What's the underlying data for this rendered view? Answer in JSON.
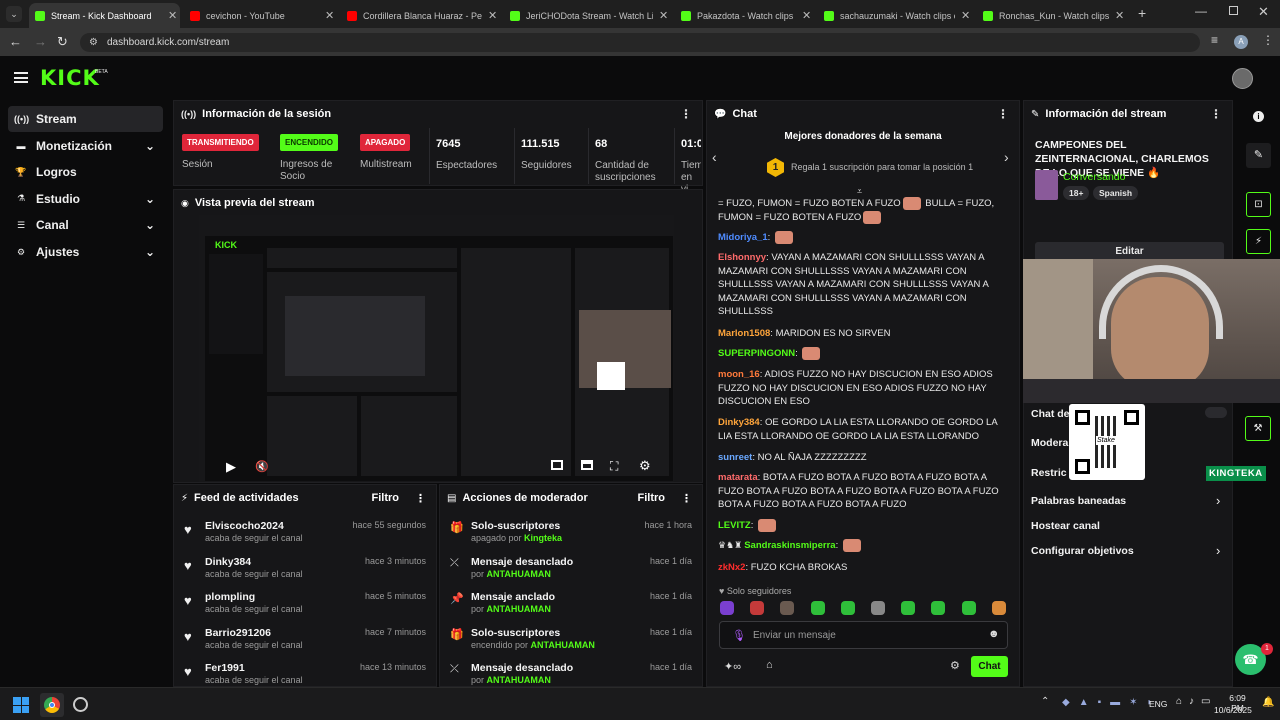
{
  "browser": {
    "tabs": [
      {
        "title": "Stream - Kick Dashboard",
        "color": "#53fc18",
        "active": true
      },
      {
        "title": "cevichon - YouTube",
        "color": "#ff0000",
        "active": false
      },
      {
        "title": "Cordillera Blanca Huaraz - Perú",
        "color": "#ff0000",
        "active": false
      },
      {
        "title": "JeriCHODota Stream - Watch Li",
        "color": "#53fc18",
        "active": false
      },
      {
        "title": "Pakazdota - Watch clips on Kick",
        "color": "#53fc18",
        "active": false
      },
      {
        "title": "sachauzumaki - Watch clips on",
        "color": "#53fc18",
        "active": false
      },
      {
        "title": "Ronchas_Kun - Watch clips on",
        "color": "#53fc18",
        "active": false
      }
    ],
    "url": "dashboard.kick.com/stream",
    "profile_initial": "A"
  },
  "logo": {
    "text": "KICK",
    "beta": "BETA"
  },
  "sidebar": {
    "items": [
      {
        "label": "Stream",
        "selected": true,
        "expandable": false
      },
      {
        "label": "Monetización",
        "selected": false,
        "expandable": true
      },
      {
        "label": "Logros",
        "selected": false,
        "expandable": false
      },
      {
        "label": "Estudio",
        "selected": false,
        "expandable": true
      },
      {
        "label": "Canal",
        "selected": false,
        "expandable": true
      },
      {
        "label": "Ajustes",
        "selected": false,
        "expandable": true
      }
    ]
  },
  "session": {
    "title": "Información de la sesión",
    "stats": [
      {
        "badge": "TRANSMITIENDO",
        "label": "Sesión"
      },
      {
        "badge": "ENCENDIDO",
        "label": "Ingresos de Socio"
      },
      {
        "badge": "APAGADO",
        "label": "Multistream"
      },
      {
        "value": "7645",
        "label": "Espectadores"
      },
      {
        "value": "111.515",
        "label": "Seguidores"
      },
      {
        "value": "68",
        "label": "Cantidad de suscripciones"
      },
      {
        "value": "01:0",
        "label": "Tiem en vi"
      }
    ]
  },
  "preview": {
    "title": "Vista previa del stream"
  },
  "feed": {
    "title": "Feed de actividades",
    "filter": "Filtro",
    "items": [
      {
        "name": "Elviscocho2024",
        "sub": "acaba de seguir el canal",
        "time": "hace 55 segundos"
      },
      {
        "name": "Dinky384",
        "sub": "acaba de seguir el canal",
        "time": "hace 3 minutos"
      },
      {
        "name": "plompling",
        "sub": "acaba de seguir el canal",
        "time": "hace 5 minutos"
      },
      {
        "name": "Barrio291206",
        "sub": "acaba de seguir el canal",
        "time": "hace 7 minutos"
      },
      {
        "name": "Fer1991",
        "sub": "acaba de seguir el canal",
        "time": "hace 13 minutos"
      }
    ]
  },
  "mod": {
    "title": "Acciones de moderador",
    "filter": "Filtro",
    "items": [
      {
        "name": "Solo-suscriptores",
        "pre": "apagado por ",
        "by": "Kingteka",
        "time": "hace 1 hora",
        "icon": "gift"
      },
      {
        "name": "Mensaje desanclado",
        "pre": "por ",
        "by": "ANTAHUAMAN",
        "time": "hace 1 día",
        "icon": "unpin"
      },
      {
        "name": "Mensaje anclado",
        "pre": "por ",
        "by": "ANTAHUAMAN",
        "time": "hace 1 día",
        "icon": "pin"
      },
      {
        "name": "Solo-suscriptores",
        "pre": "encendido por ",
        "by": "ANTAHUAMAN",
        "time": "hace 1 día",
        "icon": "gift"
      },
      {
        "name": "Mensaje desanclado",
        "pre": "por ",
        "by": "ANTAHUAMAN",
        "time": "hace 1 día",
        "icon": "unpin"
      }
    ]
  },
  "chat": {
    "title": "Chat",
    "donors_title": "Mejores donadores de la semana",
    "donor_rank": "1",
    "donor_text": "Regala 1 suscripción para tomar la posición 1",
    "messages": [
      {
        "user": "",
        "color": "#eaeaea",
        "text": "= FUZO, FUMON = FUZO BOTEN A FUZO",
        "emotes": 1,
        "tail": " BULLA = FUZO, FUMON = FUZO BOTEN A FUZO",
        "emotes2": 1
      },
      {
        "user": "Midoriya_1",
        "color": "#4f8cff",
        "text": "",
        "emotes": 1
      },
      {
        "user": "Elshonnyy",
        "color": "#ff6b6b",
        "text": "VAYAN A MAZAMARI CON SHULLLSSS VAYAN A MAZAMARI CON SHULLLSSS VAYAN A MAZAMARI CON SHULLLSSS VAYAN A MAZAMARI CON SHULLLSSS VAYAN A MAZAMARI CON SHULLLSSS VAYAN A MAZAMARI CON SHULLLSSS"
      },
      {
        "user": "Marlon1508",
        "color": "#ffa53b",
        "text": "MARIDON ES NO SIRVEN"
      },
      {
        "user": "SUPERPINGONN",
        "color": "#53fc18",
        "text": "",
        "emotes": 1
      },
      {
        "user": "moon_16",
        "color": "#ff7a3b",
        "text": "ADIOS FUZZO NO HAY DISCUCION EN ESO ADIOS FUZZO NO HAY DISCUCION EN ESO ADIOS FUZZO NO HAY DISCUCION EN ESO"
      },
      {
        "user": "Dinky384",
        "color": "#ffa53b",
        "text": "OE GORDO LA LIA ESTA LLORANDO OE GORDO LA LIA ESTA LLORANDO OE GORDO LA LIA ESTA LLORANDO"
      },
      {
        "user": "sunreet",
        "color": "#6aa8ff",
        "text": "NO AL ÑAJA ZZZZZZZZZ"
      },
      {
        "user": "matarata",
        "color": "#ff6b6b",
        "text": "BOTA A FUZO BOTA A FUZO BOTA A FUZO BOTA A FUZO BOTA A FUZO BOTA A FUZO BOTA A FUZO BOTA A FUZO BOTA A FUZO BOTA A FUZO BOTA A FUZO"
      },
      {
        "user": "LEVITZ",
        "color": "#53fc18",
        "text": "",
        "emotes": 1
      },
      {
        "user": "Sandraskinsmiperra",
        "color": "#53fc18",
        "text": "",
        "emotes": 1,
        "badges": true
      },
      {
        "user": "zkNx2",
        "color": "#ff2d2d",
        "text": "FUZO KCHA BROKAS"
      }
    ],
    "followers_only": "Solo seguidores",
    "input_placeholder": "Enviar un mensaje",
    "send_label": "Chat"
  },
  "stream_info": {
    "title": "Información del stream",
    "stream_title": "CAMPEONES DEL ZEINTERNACIONAL, CHARLEMOS DE LO QUE SE VIENE",
    "category": "Conversando",
    "age": "18+",
    "language": "Spanish",
    "edit_label": "Editar",
    "items": [
      "Chat de",
      "Modera",
      "Restric",
      "Palabras baneadas",
      "Hostear canal",
      "Configurar objetivos"
    ],
    "overlay_name": "KINGTEKA",
    "overlay_qr_label": "Stake"
  },
  "taskbar": {
    "lang": "ENG",
    "time": "6:09 PM",
    "date": "10/6/2025"
  },
  "notification_count": "1"
}
